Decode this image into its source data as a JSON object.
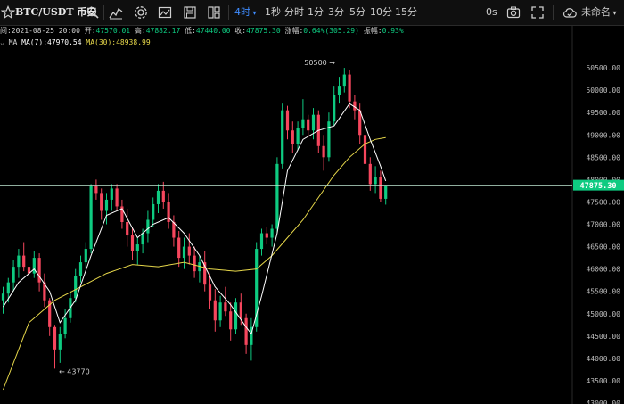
{
  "toolbar": {
    "symbol": "BTC/USDT 币安",
    "interval_selected": "4时",
    "intervals": [
      "1秒",
      "分时",
      "1分",
      "3分",
      "5分",
      "10分",
      "15分"
    ],
    "seconds_label": "0s",
    "layout_name": "未命名",
    "icons": [
      "star-icon",
      "search-icon",
      "chart-type-icon",
      "indicator-icon",
      "template-icon",
      "save-icon",
      "layout-icon",
      "camera-icon",
      "fullscreen-icon",
      "cloud-check-icon"
    ]
  },
  "info": {
    "time_label": "间:",
    "time": "2021-08-25 20:00",
    "open_label": "开:",
    "open": "47570.01",
    "high_label": "高:",
    "high": "47882.17",
    "low_label": "低:",
    "low": "47440.00",
    "close_label": "收:",
    "close": "47875.30",
    "change_label": "涨幅:",
    "change": "0.64%(305.29)",
    "amplitude_label": "振幅:",
    "amplitude": "0.93%"
  },
  "ma": {
    "name": "MA",
    "ma7_label": "MA(7):",
    "ma7_value": "47970.54",
    "ma30_label": "MA(30):",
    "ma30_value": "48938.99"
  },
  "chart_data": {
    "type": "candlestick",
    "ylim": [
      43000,
      51000
    ],
    "yticks": [
      43000,
      43500,
      44000,
      44500,
      45000,
      45500,
      46000,
      46500,
      47000,
      47500,
      48000,
      48500,
      49000,
      49500,
      50000,
      50500
    ],
    "current_price_label": "47875.30",
    "annotations": [
      {
        "text": "50500 →",
        "price": 50500
      },
      {
        "text": "← 43770",
        "price": 43770
      }
    ],
    "candles": [
      [
        45300,
        45600,
        45000,
        45450
      ],
      [
        45450,
        45800,
        45250,
        45700
      ],
      [
        45700,
        46200,
        45500,
        46050
      ],
      [
        46050,
        46450,
        45800,
        46300
      ],
      [
        46300,
        46600,
        45950,
        46050
      ],
      [
        46050,
        46200,
        45650,
        45900
      ],
      [
        45900,
        46400,
        45800,
        46250
      ],
      [
        46250,
        46350,
        45500,
        45700
      ],
      [
        45700,
        45900,
        45150,
        45300
      ],
      [
        45300,
        45350,
        44500,
        44700
      ],
      [
        44700,
        44750,
        43770,
        44200
      ],
      [
        44200,
        44700,
        43900,
        44550
      ],
      [
        44550,
        45100,
        44450,
        44900
      ],
      [
        44900,
        45500,
        44800,
        45350
      ],
      [
        45350,
        46000,
        45250,
        45850
      ],
      [
        45850,
        46300,
        45700,
        46150
      ],
      [
        46150,
        46600,
        46000,
        46450
      ],
      [
        46450,
        47900,
        46350,
        47850
      ],
      [
        47850,
        48000,
        47550,
        47700
      ],
      [
        47700,
        47800,
        47100,
        47300
      ],
      [
        47300,
        47700,
        47000,
        47550
      ],
      [
        47550,
        47900,
        47300,
        47800
      ],
      [
        47800,
        47900,
        47300,
        47400
      ],
      [
        47400,
        47550,
        46900,
        47050
      ],
      [
        47050,
        47350,
        46500,
        46750
      ],
      [
        46750,
        46950,
        46200,
        46400
      ],
      [
        46400,
        46700,
        46100,
        46550
      ],
      [
        46550,
        46900,
        46350,
        46800
      ],
      [
        46800,
        47300,
        46600,
        47100
      ],
      [
        47100,
        47600,
        46950,
        47450
      ],
      [
        47450,
        47900,
        47250,
        47750
      ],
      [
        47750,
        47950,
        47350,
        47500
      ],
      [
        47500,
        47700,
        46900,
        47050
      ],
      [
        47050,
        47200,
        46500,
        46700
      ],
      [
        46700,
        46850,
        46050,
        46250
      ],
      [
        46250,
        46700,
        46000,
        46500
      ],
      [
        46500,
        46800,
        46100,
        46300
      ],
      [
        46300,
        46500,
        45800,
        45950
      ],
      [
        45950,
        46300,
        45700,
        46150
      ],
      [
        46150,
        46400,
        45500,
        45650
      ],
      [
        45650,
        45900,
        45100,
        45300
      ],
      [
        45300,
        45550,
        44600,
        44850
      ],
      [
        44850,
        45400,
        44700,
        45250
      ],
      [
        45250,
        45600,
        44950,
        45050
      ],
      [
        45050,
        45250,
        44400,
        44650
      ],
      [
        44650,
        45350,
        44550,
        45250
      ],
      [
        45250,
        45450,
        44750,
        44900
      ],
      [
        44900,
        45000,
        44100,
        44300
      ],
      [
        44300,
        44900,
        43950,
        44700
      ],
      [
        44700,
        46600,
        44600,
        46450
      ],
      [
        46450,
        46900,
        46300,
        46800
      ],
      [
        46800,
        46950,
        46550,
        46700
      ],
      [
        46700,
        47000,
        46500,
        46900
      ],
      [
        46900,
        48500,
        46800,
        48350
      ],
      [
        48350,
        49700,
        48250,
        49550
      ],
      [
        49550,
        49650,
        48900,
        49100
      ],
      [
        49100,
        49300,
        48600,
        48800
      ],
      [
        48800,
        49300,
        48650,
        49150
      ],
      [
        49150,
        49800,
        49000,
        49350
      ],
      [
        49350,
        49450,
        48950,
        49100
      ],
      [
        49100,
        49600,
        48900,
        49450
      ],
      [
        49450,
        49550,
        48600,
        48750
      ],
      [
        48750,
        49000,
        48200,
        48500
      ],
      [
        48500,
        49500,
        48400,
        49300
      ],
      [
        49300,
        50100,
        49200,
        49900
      ],
      [
        49900,
        50300,
        49700,
        50100
      ],
      [
        50100,
        50500,
        49950,
        50350
      ],
      [
        50350,
        50450,
        49600,
        49750
      ],
      [
        49750,
        49900,
        49350,
        49550
      ],
      [
        49550,
        49700,
        48800,
        49000
      ],
      [
        49000,
        49200,
        48100,
        48350
      ],
      [
        48350,
        48500,
        47750,
        47900
      ],
      [
        47900,
        48300,
        47700,
        48050
      ],
      [
        48050,
        48200,
        47500,
        47570
      ],
      [
        47570,
        47882,
        47440,
        47875
      ]
    ],
    "ma7": [
      [
        0,
        45150
      ],
      [
        3,
        45700
      ],
      [
        6,
        46000
      ],
      [
        9,
        45500
      ],
      [
        11,
        44800
      ],
      [
        14,
        45300
      ],
      [
        17,
        46300
      ],
      [
        20,
        47200
      ],
      [
        23,
        47350
      ],
      [
        26,
        46700
      ],
      [
        29,
        47000
      ],
      [
        32,
        47150
      ],
      [
        35,
        46800
      ],
      [
        38,
        46300
      ],
      [
        41,
        45600
      ],
      [
        44,
        45200
      ],
      [
        47,
        44700
      ],
      [
        48,
        44550
      ],
      [
        50,
        45400
      ],
      [
        53,
        46800
      ],
      [
        55,
        48200
      ],
      [
        58,
        48900
      ],
      [
        61,
        49100
      ],
      [
        64,
        49200
      ],
      [
        67,
        49700
      ],
      [
        69,
        49550
      ],
      [
        71,
        48900
      ],
      [
        73,
        48300
      ],
      [
        74,
        47970
      ]
    ],
    "ma30": [
      [
        0,
        43300
      ],
      [
        5,
        44800
      ],
      [
        10,
        45300
      ],
      [
        15,
        45600
      ],
      [
        20,
        45900
      ],
      [
        25,
        46100
      ],
      [
        30,
        46050
      ],
      [
        35,
        46150
      ],
      [
        40,
        46000
      ],
      [
        45,
        45950
      ],
      [
        49,
        46000
      ],
      [
        52,
        46300
      ],
      [
        55,
        46700
      ],
      [
        58,
        47100
      ],
      [
        61,
        47600
      ],
      [
        64,
        48100
      ],
      [
        67,
        48500
      ],
      [
        70,
        48800
      ],
      [
        72,
        48900
      ],
      [
        74,
        48939
      ]
    ]
  }
}
